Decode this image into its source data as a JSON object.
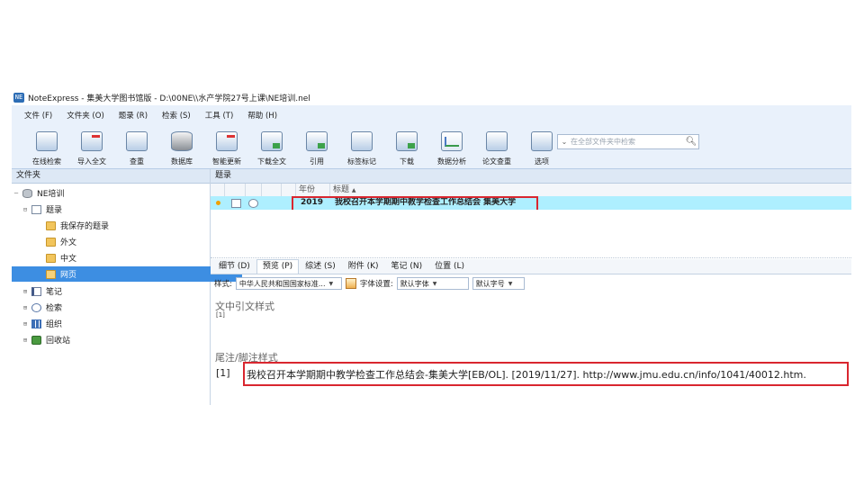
{
  "window": {
    "title": "NoteExpress - 集美大学图书馆版 - D:\\00NE\\\\水产学院27号上课\\NE培训.nel"
  },
  "menu": [
    "文件 (F)",
    "文件夹 (O)",
    "题录 (R)",
    "检索 (S)",
    "工具 (T)",
    "帮助 (H)"
  ],
  "toolbar": [
    {
      "label": "在线检索",
      "icon": "online-search-icon"
    },
    {
      "label": "导入全文",
      "icon": "import-fulltext-icon"
    },
    {
      "label": "查重",
      "icon": "duplicate-check-icon"
    },
    {
      "label": "数据库",
      "icon": "database-icon"
    },
    {
      "label": "智能更新",
      "icon": "smart-update-icon"
    },
    {
      "label": "下载全文",
      "icon": "download-fulltext-icon"
    },
    {
      "label": "引用",
      "icon": "cite-icon"
    },
    {
      "label": "标签标记",
      "icon": "tag-icon"
    },
    {
      "label": "下载",
      "icon": "download-icon"
    },
    {
      "label": "数据分析",
      "icon": "analysis-icon"
    },
    {
      "label": "论文查重",
      "icon": "paper-check-icon"
    },
    {
      "label": "选项",
      "icon": "options-icon"
    }
  ],
  "search": {
    "placeholder": "在全部文件夹中检索"
  },
  "folders": {
    "header": "文件夹",
    "items": [
      "NE培训",
      "题录",
      "我保存的题录",
      "外文",
      "中文",
      "网页",
      "笔记",
      "检索",
      "组织",
      "回收站"
    ]
  },
  "refs": {
    "header": "题录",
    "columns": {
      "year": "年份",
      "title": "标题"
    },
    "rows": [
      {
        "year": "2019",
        "title": "我校召开本学期期中教学检查工作总结会 集美大学"
      }
    ]
  },
  "tabs": [
    "细节 (D)",
    "预览 (P)",
    "综述 (S)",
    "附件 (K)",
    "笔记 (N)",
    "位置 (L)"
  ],
  "style_bar": {
    "style_label": "样式:",
    "style_value": "中华人民共和国国家标准...",
    "font_label": "字体设置:",
    "font_value": "默认字体",
    "size_value": "默认字号"
  },
  "preview": {
    "intext_heading": "文中引文样式",
    "intext_value": "[1]",
    "footnote_heading": "尾注/脚注样式",
    "ref_num": "[1]",
    "citation": "我校召开本学期期中教学检查工作总结会-集美大学[EB/OL]. [2019/11/27]. http://www.jmu.edu.cn/info/1041/40012.htm."
  },
  "colors": {
    "highlight": "#d9262f",
    "selected_row": "#aeefff",
    "selected_folder": "#3d8ee2"
  }
}
